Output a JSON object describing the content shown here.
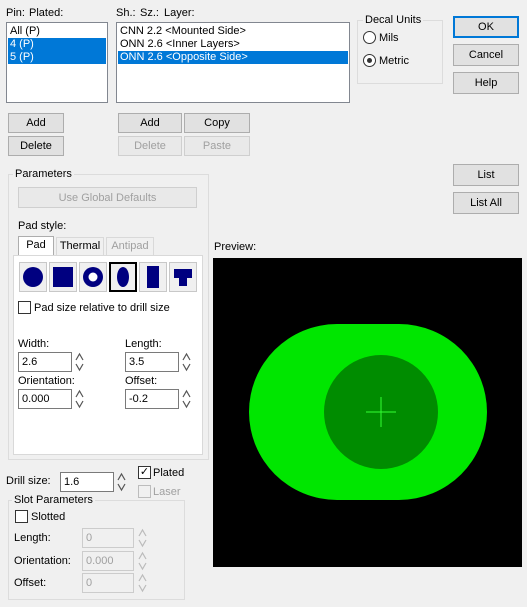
{
  "pins": {
    "header_pin": "Pin:",
    "header_plated": "Plated:",
    "items": [
      {
        "label": "All (P)",
        "selected": false
      },
      {
        "label": "4 (P)",
        "selected": true
      },
      {
        "label": "5 (P)",
        "selected": true
      }
    ],
    "add_label": "Add",
    "delete_label": "Delete"
  },
  "layers": {
    "header_sh": "Sh.:",
    "header_sz": "Sz.:",
    "header_layer": "Layer:",
    "items": [
      {
        "label": "CNN 2.2 <Mounted Side>",
        "selected": false
      },
      {
        "label": "ONN 2.6 <Inner Layers>",
        "selected": false
      },
      {
        "label": "ONN 2.6 <Opposite Side>",
        "selected": true
      }
    ],
    "add_label": "Add",
    "copy_label": "Copy",
    "delete_label": "Delete",
    "paste_label": "Paste"
  },
  "decal_units": {
    "title": "Decal Units",
    "mils_label": "Mils",
    "metric_label": "Metric",
    "selected": "Metric"
  },
  "dialog_buttons": {
    "ok": "OK",
    "cancel": "Cancel",
    "help": "Help",
    "list": "List",
    "list_all": "List All"
  },
  "parameters": {
    "title": "Parameters",
    "use_global_defaults": "Use Global Defaults",
    "pad_style_label": "Pad style:",
    "tabs": [
      {
        "label": "Pad",
        "active": true,
        "enabled": true
      },
      {
        "label": "Thermal",
        "active": false,
        "enabled": true
      },
      {
        "label": "Antipad",
        "active": false,
        "enabled": false
      }
    ],
    "shapes": [
      {
        "icon": "round-pad-icon",
        "selected": false
      },
      {
        "icon": "square-pad-icon",
        "selected": false
      },
      {
        "icon": "annular-pad-icon",
        "selected": false
      },
      {
        "icon": "oval-pad-icon",
        "selected": true
      },
      {
        "icon": "rectangle-pad-icon",
        "selected": false
      },
      {
        "icon": "custom-pad-icon",
        "selected": false
      }
    ],
    "relative_label": "Pad size relative to drill size",
    "width_label": "Width:",
    "width_value": "2.6",
    "length_label": "Length:",
    "length_value": "3.5",
    "orientation_label": "Orientation:",
    "orientation_value": "0.000",
    "offset_label": "Offset:",
    "offset_value": "-0.2"
  },
  "drill": {
    "label": "Drill size:",
    "value": "1.6",
    "plated_label": "Plated",
    "plated_checked": true,
    "laser_label": "Laser",
    "laser_checked": false
  },
  "slot": {
    "title": "Slot Parameters",
    "slotted_label": "Slotted",
    "length_label": "Length:",
    "length_value": "0",
    "orientation_label": "Orientation:",
    "orientation_value": "0.000",
    "offset_label": "Offset:",
    "offset_value": "0"
  },
  "preview": {
    "label": "Preview:",
    "background": "#000000",
    "pad_color": "#00e600",
    "drill_color": "#008c00",
    "crosshair_color": "#33ff33"
  }
}
